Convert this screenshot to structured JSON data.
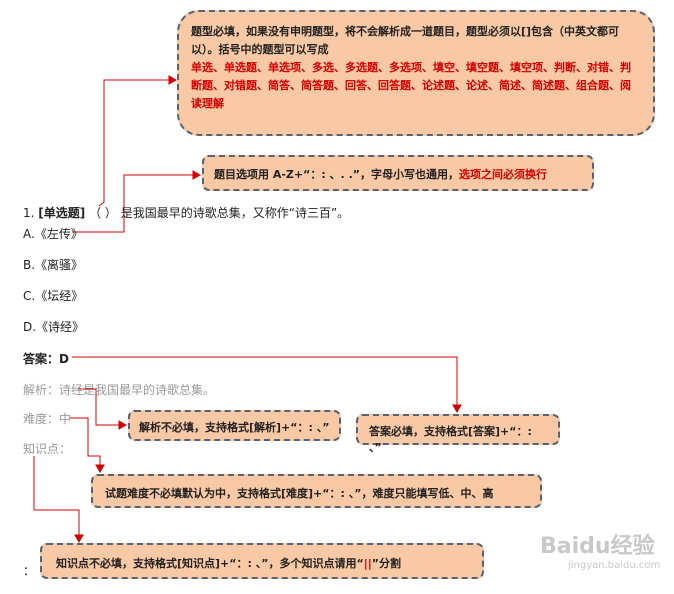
{
  "question": {
    "number": "1.",
    "type_tag": "[单选题]",
    "paren": "（    ）",
    "stem": "是我国最早的诗歌总集，又称作“诗三百”。",
    "options": [
      "A.《左传》",
      "B.《离骚》",
      "C.《坛经》",
      "D.《诗经》"
    ]
  },
  "answer": {
    "label": "答案：D"
  },
  "analysis": {
    "text": "解析：诗经是我国最早的诗歌总集。"
  },
  "difficulty": {
    "text": "难度：中"
  },
  "knowledge": {
    "text": "知识点："
  },
  "trailing_mark": "：",
  "callouts": {
    "type_note": "题型必填，如果没有申明题型，将不会解析成一道题目，题型必须以[]包含（中英文都可以）。括号中的题型可以写成",
    "type_list": "单选、单选题、单选项、多选、多选题、多选项、填空、填空题、填空项、判断、对错、判断题、对错题、简答、简答题、回答、回答题、论述题、论述、简述、简述题、组合题、阅读理解",
    "option_note": "题目选项用 A-Z+“：: 、. .”，字母小写也通用，",
    "option_note_red": "选项之间必须换行",
    "analysis_note": "解析不必填，支持格式[解析]+“：: 、”",
    "answer_note": "答案必填，支持格式[答案]+“：: 、”",
    "difficulty_note": "试题难度不必填默认为中，支持格式[难度]+“：: 、”，难度只能填写低、中、高",
    "knowledge_note_a": "知识点不必填，支持格式[知识点]+“：: 、”，多个知识点请用“",
    "knowledge_note_sep": "||",
    "knowledge_note_b": "”分割"
  },
  "watermark": {
    "brand": "Baidu经验",
    "url": "jingyan.baidu.com"
  },
  "colors": {
    "callout_fill": "#f9c8a4",
    "callout_border": "#556474",
    "red": "#d40000",
    "line": "#d40000"
  }
}
